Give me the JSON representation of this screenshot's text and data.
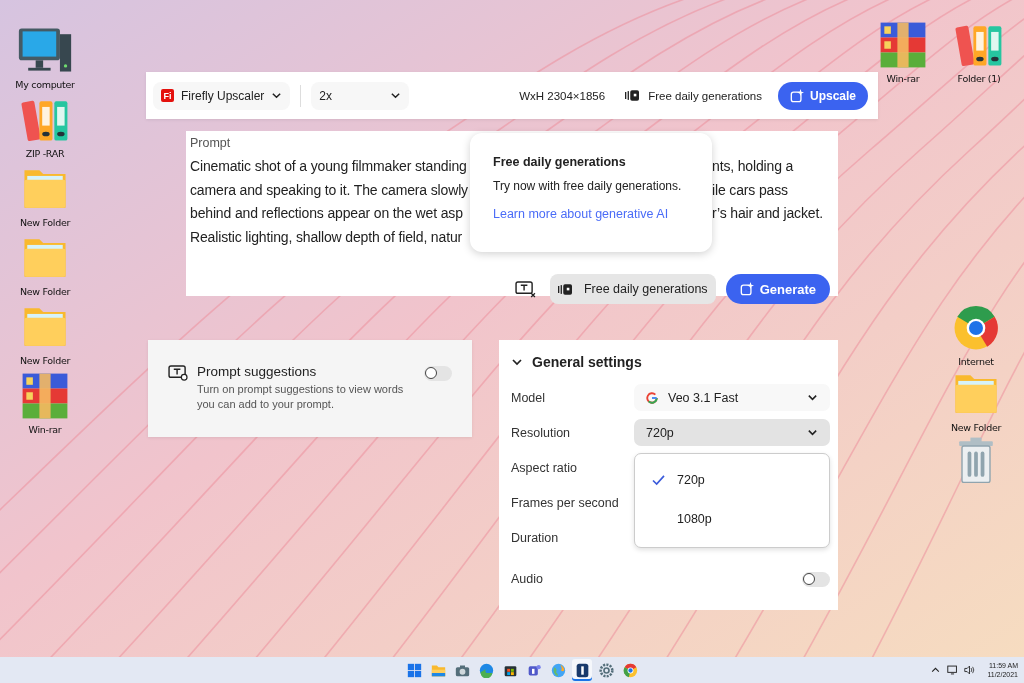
{
  "desktop": {
    "left": [
      {
        "kind": "computer",
        "label": "My computer"
      },
      {
        "kind": "binders",
        "label": "ZIP -RAR"
      },
      {
        "kind": "folder",
        "label": "New Folder"
      },
      {
        "kind": "folder",
        "label": "New Folder"
      },
      {
        "kind": "folder",
        "label": "New Folder"
      },
      {
        "kind": "archive",
        "label": "Win-rar"
      }
    ],
    "right_top": [
      {
        "kind": "archive",
        "label": "Win-rar"
      },
      {
        "kind": "binders",
        "label": "Folder (1)"
      }
    ],
    "right": [
      {
        "kind": "browser",
        "label": "Internet"
      },
      {
        "kind": "folder",
        "label": "New Folder"
      },
      {
        "kind": "trash"
      }
    ]
  },
  "toolbar": {
    "logo_text": "Fi",
    "app_menu": "Firefly Upscaler",
    "scale": "2x",
    "dimensions": "WxH 2304×1856",
    "credits": "Free daily generations",
    "action": "Upscale"
  },
  "prompt": {
    "label": "Prompt",
    "lines": [
      {
        "left": "Cinematic shot of a young filmmaker standing",
        "right": "nts, holding a"
      },
      {
        "left": "camera and speaking to it. The camera slowly",
        "right": "ile cars pass"
      },
      {
        "left": "behind and reflections appear on the wet asp",
        "right": "r’s hair and jacket."
      },
      {
        "left": "Realistic lighting, shallow depth of field, natur"
      }
    ],
    "credits": "Free daily generations",
    "action": "Generate"
  },
  "popover": {
    "title": "Free daily generations",
    "body": "Try now with free daily generations.",
    "link": "Learn more about generative AI"
  },
  "suggestions": {
    "title": "Prompt suggestions",
    "description": "Turn on prompt suggestions to view words you can add to your prompt.",
    "on": false
  },
  "settings": {
    "title": "General settings",
    "expanded": true,
    "rows": [
      {
        "kind": "select",
        "label": "Model",
        "value": "Veo 3.1 Fast",
        "logo": true,
        "open": false
      },
      {
        "kind": "select",
        "label": "Resolution",
        "value": "720p",
        "open": true
      },
      {
        "kind": "plain",
        "label": "Aspect ratio"
      },
      {
        "kind": "plain",
        "label": "Frames per second"
      },
      {
        "kind": "plain",
        "label": "Duration"
      },
      {
        "kind": "toggle",
        "label": "Audio",
        "on": false
      }
    ],
    "menu": [
      {
        "label": "720p",
        "selected": true
      },
      {
        "label": "1080p",
        "selected": false
      }
    ]
  },
  "taskbar": {
    "apps": [
      {
        "kind": "start",
        "selected": false
      },
      {
        "kind": "explorer",
        "selected": false
      },
      {
        "kind": "camera",
        "selected": false
      },
      {
        "kind": "edge",
        "selected": false
      },
      {
        "kind": "store",
        "selected": false
      },
      {
        "kind": "teams",
        "selected": false
      },
      {
        "kind": "globe",
        "selected": false
      },
      {
        "kind": "app",
        "selected": true
      },
      {
        "kind": "settings",
        "selected": false
      },
      {
        "kind": "chrome",
        "selected": false
      }
    ],
    "time": "11:59 AM",
    "date": "11/2/2021"
  }
}
